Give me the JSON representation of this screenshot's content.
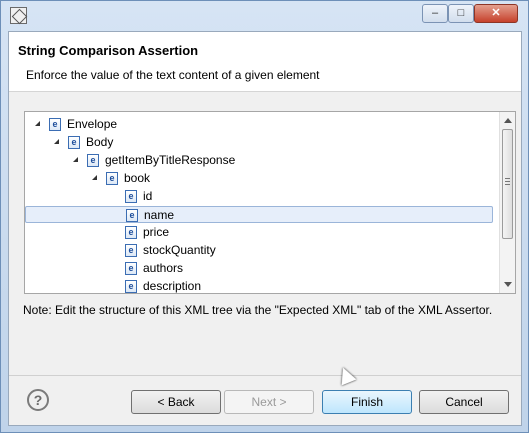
{
  "window": {
    "controls": {
      "minimize": "–",
      "maximize": "□",
      "close": "✕"
    }
  },
  "header": {
    "title": "String Comparison Assertion",
    "description": "Enforce the value of the text content of a given element"
  },
  "tree": {
    "element_icon_letter": "e",
    "selected_index": 5,
    "nodes": [
      {
        "label": "Envelope",
        "depth": 0,
        "expanded": true
      },
      {
        "label": "Body",
        "depth": 1,
        "expanded": true
      },
      {
        "label": "getItemByTitleResponse",
        "depth": 2,
        "expanded": true
      },
      {
        "label": "book",
        "depth": 3,
        "expanded": true
      },
      {
        "label": "id",
        "depth": 4,
        "expanded": false
      },
      {
        "label": "name",
        "depth": 4,
        "expanded": false
      },
      {
        "label": "price",
        "depth": 4,
        "expanded": false
      },
      {
        "label": "stockQuantity",
        "depth": 4,
        "expanded": false
      },
      {
        "label": "authors",
        "depth": 4,
        "expanded": false
      },
      {
        "label": "description",
        "depth": 4,
        "expanded": false
      }
    ]
  },
  "note": "Note: Edit the structure of this XML tree via the \"Expected XML\" tab of the XML Assertor.",
  "footer": {
    "help_glyph": "?",
    "back_label": "< Back",
    "next_label": "Next >",
    "finish_label": "Finish",
    "cancel_label": "Cancel"
  }
}
